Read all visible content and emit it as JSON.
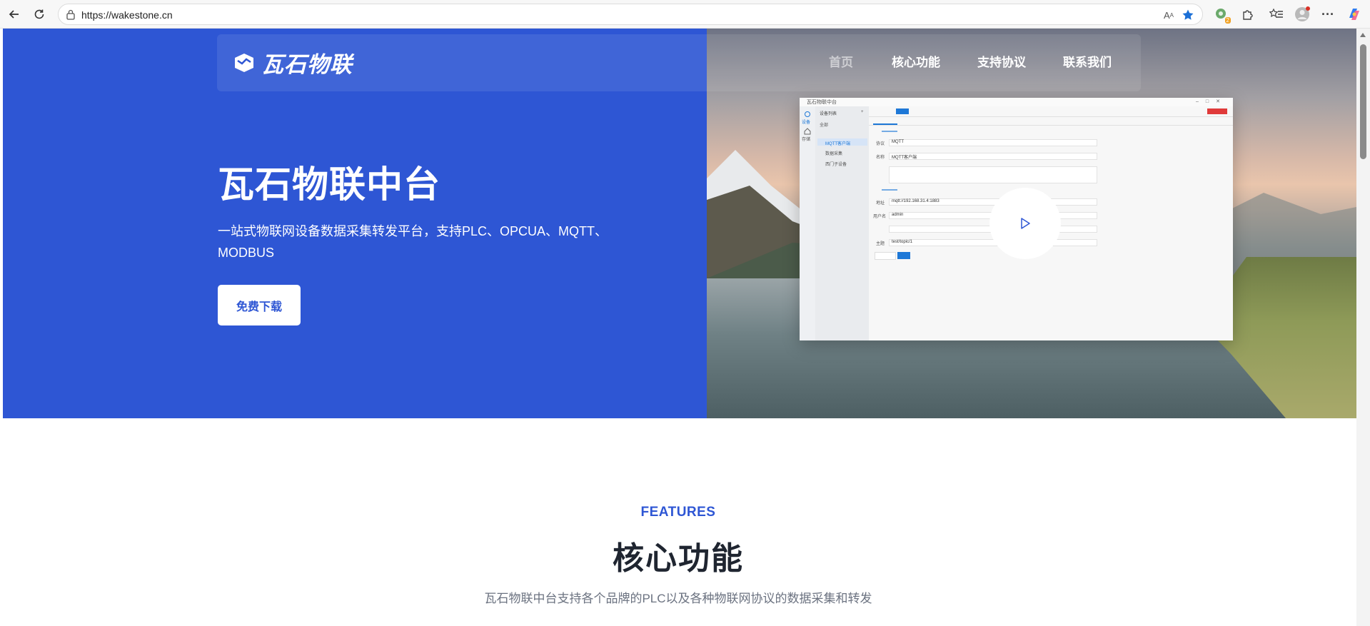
{
  "browser": {
    "url": "https://wakestone.cn",
    "extension_badge": "2"
  },
  "header": {
    "logo_text": "瓦石物联",
    "nav": [
      "首页",
      "核心功能",
      "支持协议",
      "联系我们"
    ]
  },
  "hero": {
    "title": "瓦石物联中台",
    "subtitle": "一站式物联网设备数据采集转发平台，支持PLC、OPCUA、MQTT、MODBUS",
    "download_label": "免费下载"
  },
  "app_preview": {
    "window_title": "瓦石物联中台",
    "sidebar_items": [
      "设备列表",
      "全部",
      "MQTT客户端",
      "数据采集",
      "西门子设备"
    ],
    "rail_items": [
      "设备",
      "存储"
    ],
    "form_rows": [
      {
        "label": "协议",
        "value": "MQTT"
      },
      {
        "label": "名称",
        "value": "MQTT客户端"
      },
      {
        "label": "地址",
        "value": "mqtt://192.168.31.4:1883"
      },
      {
        "label": "用户名",
        "value": "admin"
      },
      {
        "label": "主题",
        "value": "test/topic/1"
      }
    ]
  },
  "features": {
    "tag": "FEATURES",
    "title": "核心功能",
    "description": "瓦石物联中台支持各个品牌的PLC以及各种物联网协议的数据采集和转发"
  },
  "colors": {
    "brand_blue": "#2e56d4",
    "title_dark": "#1f2530",
    "muted_text": "#6b7280"
  }
}
